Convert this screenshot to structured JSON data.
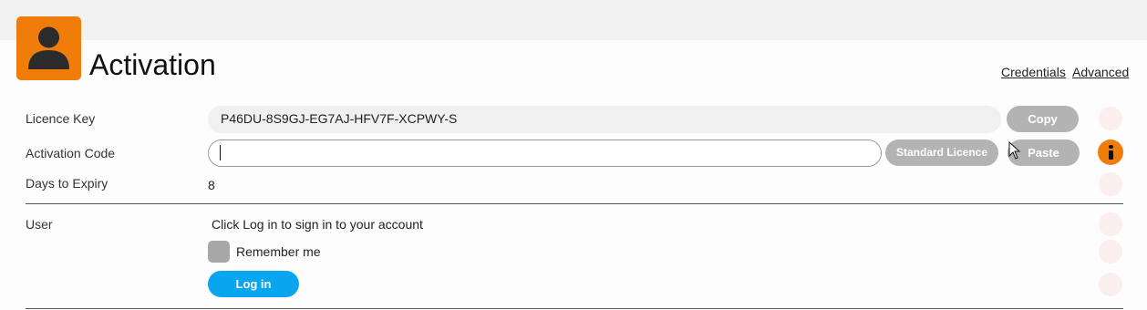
{
  "header": {
    "title": "Activation",
    "icon": "user-profile-icon",
    "links": {
      "credentials": "Credentials",
      "advanced": "Advanced"
    }
  },
  "licence": {
    "label": "Licence Key",
    "value": "P46DU-8S9GJ-EG7AJ-HFV7F-XCPWY-S",
    "copy_button": "Copy"
  },
  "activation": {
    "label": "Activation Code",
    "input_value": "",
    "standard_licence_button": "Standard Licence",
    "paste_button": "Paste"
  },
  "expiry": {
    "label": "Days to Expiry",
    "value": "8"
  },
  "user": {
    "label": "User",
    "prompt": "Click Log in to sign in to your account",
    "remember_label": "Remember me",
    "login_button": "Log in"
  },
  "colors": {
    "accent_orange": "#f07d0a",
    "button_grey": "#b3b3b3",
    "button_blue": "#0aa5ef"
  }
}
